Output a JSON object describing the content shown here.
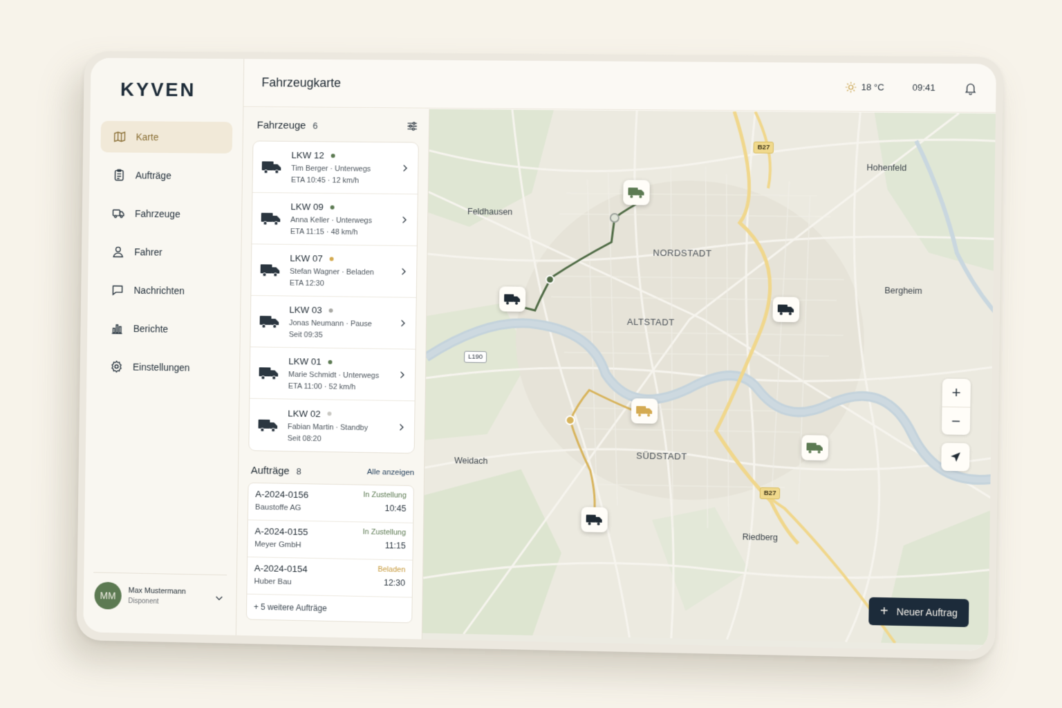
{
  "app": {
    "logo": "KYVEN"
  },
  "sidebar": {
    "items": [
      {
        "label": "Karte",
        "icon": "map-icon",
        "active": true
      },
      {
        "label": "Aufträge",
        "icon": "clipboard-icon"
      },
      {
        "label": "Fahrzeuge",
        "icon": "truck-icon"
      },
      {
        "label": "Fahrer",
        "icon": "user-icon"
      },
      {
        "label": "Nachrichten",
        "icon": "chat-icon"
      },
      {
        "label": "Berichte",
        "icon": "bar-chart-icon"
      },
      {
        "label": "Einstellungen",
        "icon": "gear-icon"
      }
    ],
    "user": {
      "initials": "MM",
      "name": "Max Mustermann",
      "role": "Disponent"
    }
  },
  "header": {
    "title": "Fahrzeugkarte",
    "temperature": "18 °C",
    "time": "09:41"
  },
  "vehicles": {
    "title": "Fahrzeuge",
    "count": "6",
    "items": [
      {
        "name": "LKW 12",
        "status_color": "#5c7a52",
        "sub": "Tim Berger · Unterwegs",
        "eta": "ETA 10:45 · 12 km/h"
      },
      {
        "name": "LKW 09",
        "status_color": "#5c7a52",
        "sub": "Anna Keller · Unterwegs",
        "eta": "ETA 11:15 · 48 km/h"
      },
      {
        "name": "LKW 07",
        "status_color": "#d4aa50",
        "sub": "Stefan Wagner · Beladen",
        "eta": "ETA 12:30"
      },
      {
        "name": "LKW 03",
        "status_color": "#a9a9a4",
        "sub": "Jonas Neumann · Pause",
        "eta": "Seit 09:35"
      },
      {
        "name": "LKW 01",
        "status_color": "#5c7a52",
        "sub": "Marie Schmidt · Unterwegs",
        "eta": "ETA 11:00 · 52 km/h"
      },
      {
        "name": "LKW 02",
        "status_color": "#c9c8c3",
        "sub": "Fabian Martin · Standby",
        "eta": "Seit 08:20"
      }
    ]
  },
  "orders": {
    "title": "Aufträge",
    "count": "8",
    "show_all": "Alle anzeigen",
    "items": [
      {
        "id": "A-2024-0156",
        "customer": "Baustoffe AG",
        "status": "In Zustellung",
        "status_color": "#5c7a52",
        "time": "10:45"
      },
      {
        "id": "A-2024-0155",
        "customer": "Meyer GmbH",
        "status": "In Zustellung",
        "status_color": "#5c7a52",
        "time": "11:15"
      },
      {
        "id": "A-2024-0154",
        "customer": "Huber Bau",
        "status": "Beladen",
        "status_color": "#c79a3c",
        "time": "12:30"
      }
    ],
    "more": "+ 5 weitere Aufträge"
  },
  "map": {
    "places": [
      "Feldhausen",
      "Hohenfeld",
      "Bergheim",
      "Weidach",
      "Riedberg"
    ],
    "districts": [
      "NORDSTADT",
      "ALTSTADT",
      "SÜDSTADT"
    ],
    "roads": [
      "B27",
      "B27",
      "L190"
    ],
    "zoom_in": "+",
    "zoom_out": "−"
  },
  "actions": {
    "new_order": "Neuer Auftrag"
  }
}
